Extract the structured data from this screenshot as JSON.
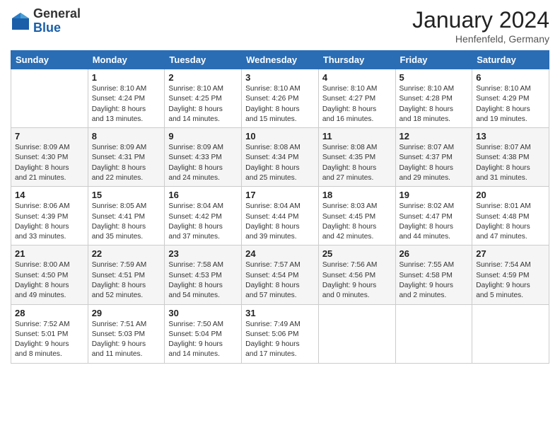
{
  "header": {
    "logo": {
      "general": "General",
      "blue": "Blue"
    },
    "title": "January 2024",
    "location": "Henfenfeld, Germany"
  },
  "weekdays": [
    "Sunday",
    "Monday",
    "Tuesday",
    "Wednesday",
    "Thursday",
    "Friday",
    "Saturday"
  ],
  "weeks": [
    [
      {
        "day": "",
        "info": ""
      },
      {
        "day": "1",
        "info": "Sunrise: 8:10 AM\nSunset: 4:24 PM\nDaylight: 8 hours\nand 13 minutes."
      },
      {
        "day": "2",
        "info": "Sunrise: 8:10 AM\nSunset: 4:25 PM\nDaylight: 8 hours\nand 14 minutes."
      },
      {
        "day": "3",
        "info": "Sunrise: 8:10 AM\nSunset: 4:26 PM\nDaylight: 8 hours\nand 15 minutes."
      },
      {
        "day": "4",
        "info": "Sunrise: 8:10 AM\nSunset: 4:27 PM\nDaylight: 8 hours\nand 16 minutes."
      },
      {
        "day": "5",
        "info": "Sunrise: 8:10 AM\nSunset: 4:28 PM\nDaylight: 8 hours\nand 18 minutes."
      },
      {
        "day": "6",
        "info": "Sunrise: 8:10 AM\nSunset: 4:29 PM\nDaylight: 8 hours\nand 19 minutes."
      }
    ],
    [
      {
        "day": "7",
        "info": "Sunrise: 8:09 AM\nSunset: 4:30 PM\nDaylight: 8 hours\nand 21 minutes."
      },
      {
        "day": "8",
        "info": "Sunrise: 8:09 AM\nSunset: 4:31 PM\nDaylight: 8 hours\nand 22 minutes."
      },
      {
        "day": "9",
        "info": "Sunrise: 8:09 AM\nSunset: 4:33 PM\nDaylight: 8 hours\nand 24 minutes."
      },
      {
        "day": "10",
        "info": "Sunrise: 8:08 AM\nSunset: 4:34 PM\nDaylight: 8 hours\nand 25 minutes."
      },
      {
        "day": "11",
        "info": "Sunrise: 8:08 AM\nSunset: 4:35 PM\nDaylight: 8 hours\nand 27 minutes."
      },
      {
        "day": "12",
        "info": "Sunrise: 8:07 AM\nSunset: 4:37 PM\nDaylight: 8 hours\nand 29 minutes."
      },
      {
        "day": "13",
        "info": "Sunrise: 8:07 AM\nSunset: 4:38 PM\nDaylight: 8 hours\nand 31 minutes."
      }
    ],
    [
      {
        "day": "14",
        "info": "Sunrise: 8:06 AM\nSunset: 4:39 PM\nDaylight: 8 hours\nand 33 minutes."
      },
      {
        "day": "15",
        "info": "Sunrise: 8:05 AM\nSunset: 4:41 PM\nDaylight: 8 hours\nand 35 minutes."
      },
      {
        "day": "16",
        "info": "Sunrise: 8:04 AM\nSunset: 4:42 PM\nDaylight: 8 hours\nand 37 minutes."
      },
      {
        "day": "17",
        "info": "Sunrise: 8:04 AM\nSunset: 4:44 PM\nDaylight: 8 hours\nand 39 minutes."
      },
      {
        "day": "18",
        "info": "Sunrise: 8:03 AM\nSunset: 4:45 PM\nDaylight: 8 hours\nand 42 minutes."
      },
      {
        "day": "19",
        "info": "Sunrise: 8:02 AM\nSunset: 4:47 PM\nDaylight: 8 hours\nand 44 minutes."
      },
      {
        "day": "20",
        "info": "Sunrise: 8:01 AM\nSunset: 4:48 PM\nDaylight: 8 hours\nand 47 minutes."
      }
    ],
    [
      {
        "day": "21",
        "info": "Sunrise: 8:00 AM\nSunset: 4:50 PM\nDaylight: 8 hours\nand 49 minutes."
      },
      {
        "day": "22",
        "info": "Sunrise: 7:59 AM\nSunset: 4:51 PM\nDaylight: 8 hours\nand 52 minutes."
      },
      {
        "day": "23",
        "info": "Sunrise: 7:58 AM\nSunset: 4:53 PM\nDaylight: 8 hours\nand 54 minutes."
      },
      {
        "day": "24",
        "info": "Sunrise: 7:57 AM\nSunset: 4:54 PM\nDaylight: 8 hours\nand 57 minutes."
      },
      {
        "day": "25",
        "info": "Sunrise: 7:56 AM\nSunset: 4:56 PM\nDaylight: 9 hours\nand 0 minutes."
      },
      {
        "day": "26",
        "info": "Sunrise: 7:55 AM\nSunset: 4:58 PM\nDaylight: 9 hours\nand 2 minutes."
      },
      {
        "day": "27",
        "info": "Sunrise: 7:54 AM\nSunset: 4:59 PM\nDaylight: 9 hours\nand 5 minutes."
      }
    ],
    [
      {
        "day": "28",
        "info": "Sunrise: 7:52 AM\nSunset: 5:01 PM\nDaylight: 9 hours\nand 8 minutes."
      },
      {
        "day": "29",
        "info": "Sunrise: 7:51 AM\nSunset: 5:03 PM\nDaylight: 9 hours\nand 11 minutes."
      },
      {
        "day": "30",
        "info": "Sunrise: 7:50 AM\nSunset: 5:04 PM\nDaylight: 9 hours\nand 14 minutes."
      },
      {
        "day": "31",
        "info": "Sunrise: 7:49 AM\nSunset: 5:06 PM\nDaylight: 9 hours\nand 17 minutes."
      },
      {
        "day": "",
        "info": ""
      },
      {
        "day": "",
        "info": ""
      },
      {
        "day": "",
        "info": ""
      }
    ]
  ]
}
